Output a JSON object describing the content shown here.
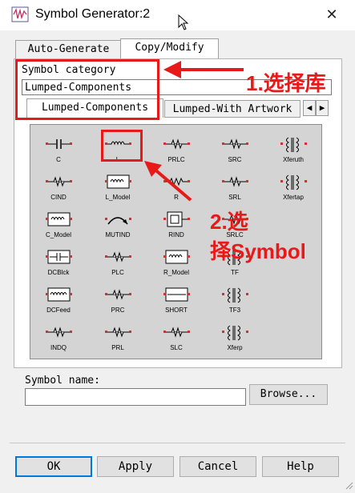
{
  "window": {
    "title": "Symbol Generator:2",
    "close_glyph": "✕"
  },
  "tabs": [
    {
      "label": "Auto-Generate",
      "active": false
    },
    {
      "label": "Copy/Modify",
      "active": true
    }
  ],
  "category": {
    "label": "Symbol category",
    "value": "Lumped-Components",
    "subtabs": [
      {
        "label": "Lumped-Components",
        "active": true
      },
      {
        "label": "Lumped-With Artwork",
        "active": false
      }
    ]
  },
  "symbols": [
    {
      "label": "C",
      "icon": "capacitor-icon"
    },
    {
      "label": "L",
      "icon": "inductor-icon"
    },
    {
      "label": "PRLC",
      "icon": "prlc-icon"
    },
    {
      "label": "SRC",
      "icon": "src-icon"
    },
    {
      "label": "Xferuth",
      "icon": "transformer-icon"
    },
    {
      "label": "CIND",
      "icon": "cind-icon"
    },
    {
      "label": "L_Model",
      "icon": "model-box-icon"
    },
    {
      "label": "R",
      "icon": "resistor-icon"
    },
    {
      "label": "SRL",
      "icon": "srl-icon"
    },
    {
      "label": "Xfertap",
      "icon": "transformer-icon"
    },
    {
      "label": "C_Model",
      "icon": "model-box-icon"
    },
    {
      "label": "MUTIND",
      "icon": "mutual-inductor-icon"
    },
    {
      "label": "RIND",
      "icon": "rind-icon"
    },
    {
      "label": "SRLC",
      "icon": "srlc-icon"
    },
    {
      "label": "",
      "icon": ""
    },
    {
      "label": "DCBlck",
      "icon": "dcblock-icon"
    },
    {
      "label": "PLC",
      "icon": "plc-icon"
    },
    {
      "label": "R_Model",
      "icon": "model-box-icon"
    },
    {
      "label": "TF",
      "icon": "transformer-icon"
    },
    {
      "label": "",
      "icon": ""
    },
    {
      "label": "DCFeed",
      "icon": "dcfeed-icon"
    },
    {
      "label": "PRC",
      "icon": "prc-icon"
    },
    {
      "label": "SHORT",
      "icon": "short-icon"
    },
    {
      "label": "TF3",
      "icon": "transformer-icon"
    },
    {
      "label": "",
      "icon": ""
    },
    {
      "label": "INDQ",
      "icon": "indq-icon"
    },
    {
      "label": "PRL",
      "icon": "prl-icon"
    },
    {
      "label": "SLC",
      "icon": "slc-icon"
    },
    {
      "label": "Xferp",
      "icon": "transformer-icon"
    },
    {
      "label": "",
      "icon": ""
    }
  ],
  "symbol_name": {
    "label": "Symbol name:",
    "value": "",
    "browse_label": "Browse..."
  },
  "buttons": {
    "ok": "OK",
    "apply": "Apply",
    "cancel": "Cancel",
    "help": "Help"
  },
  "annotations": {
    "step1": "1.选择库",
    "step2_line1": "2.选",
    "step2_line2": "择Symbol",
    "color": "#e81919"
  }
}
